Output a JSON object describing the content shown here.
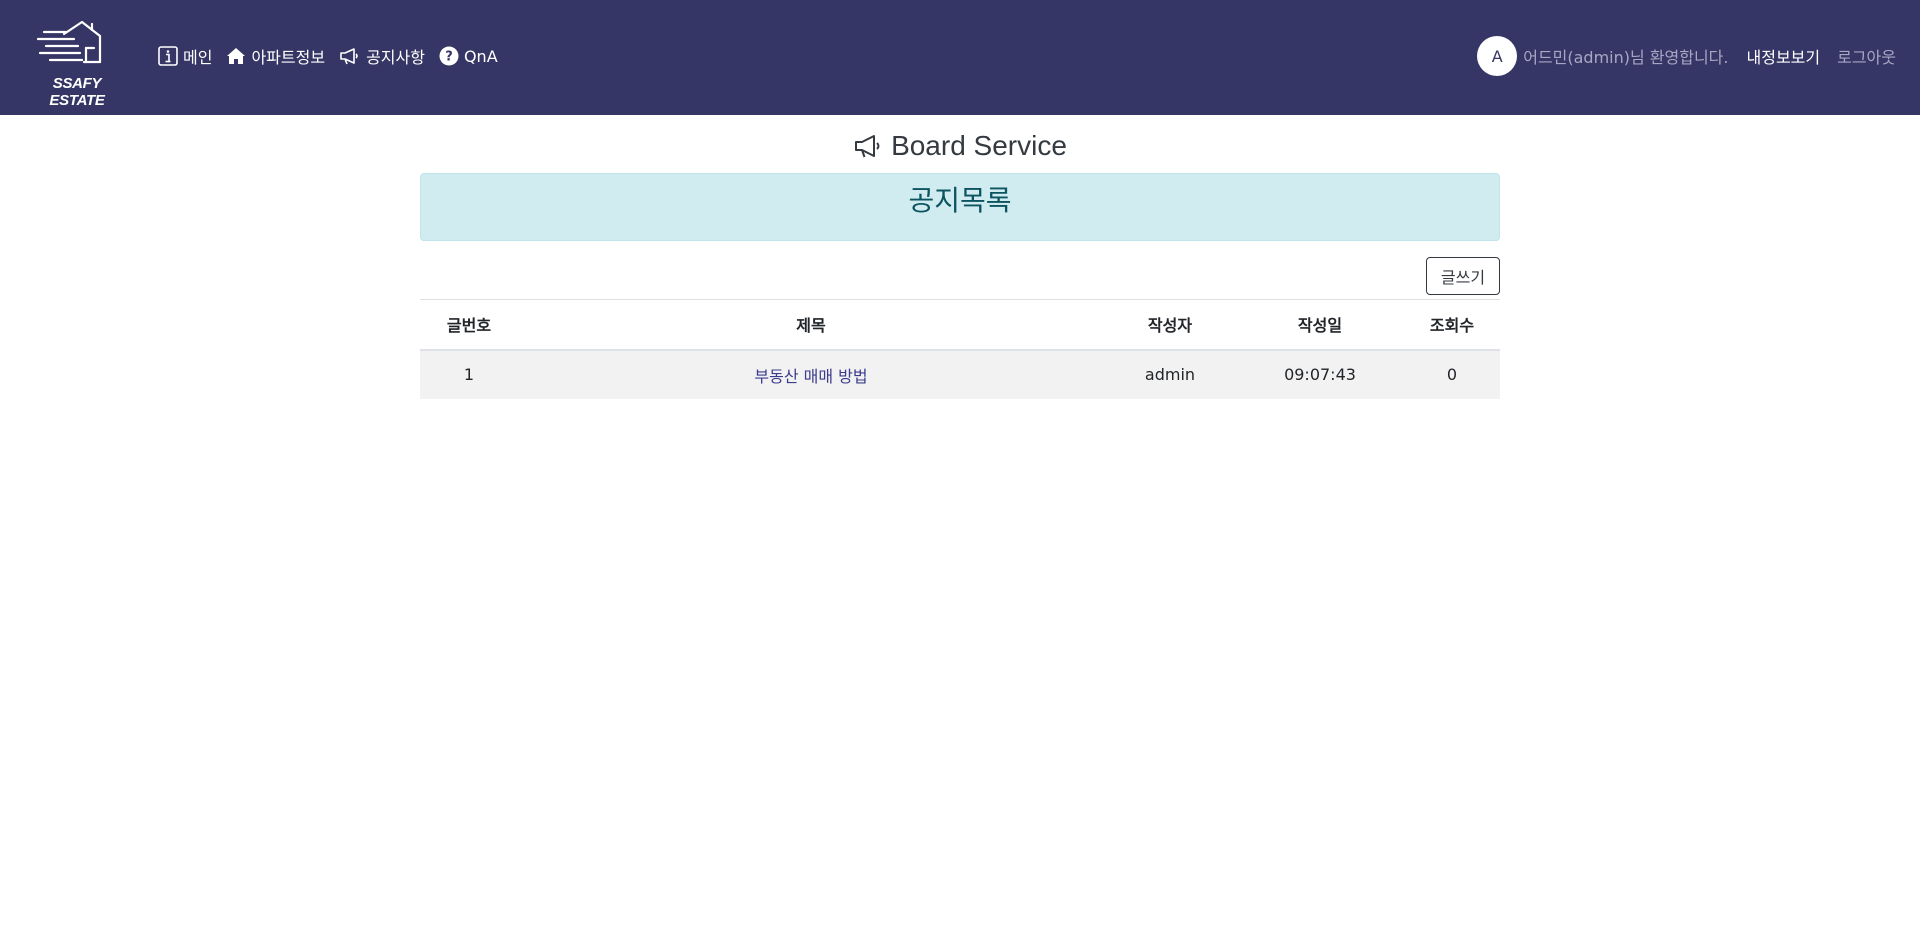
{
  "brand": {
    "name": "SSAFY ESTATE"
  },
  "nav": {
    "items": [
      {
        "label": "메인",
        "icon": "info-icon"
      },
      {
        "label": "아파트정보",
        "icon": "house-icon"
      },
      {
        "label": "공지사항",
        "icon": "megaphone-icon"
      },
      {
        "label": "QnA",
        "icon": "question-circle-icon"
      }
    ]
  },
  "user": {
    "avatar_initial": "A",
    "welcome": "어드민(admin)님 환영합니다.",
    "mypage": "내정보보기",
    "logout": "로그아웃"
  },
  "page": {
    "title": "Board Service",
    "section_title": "공지목록",
    "write_button": "글쓰기"
  },
  "table": {
    "headers": [
      "글번호",
      "제목",
      "작성자",
      "작성일",
      "조회수"
    ],
    "rows": [
      {
        "no": "1",
        "title": "부동산 매매 방법",
        "writer": "admin",
        "date": "09:07:43",
        "hit": "0"
      }
    ]
  },
  "colors": {
    "navbar": "#363666",
    "alert_bg": "#d1ecf1",
    "alert_text": "#0c5460",
    "link": "#3b3b8e"
  }
}
